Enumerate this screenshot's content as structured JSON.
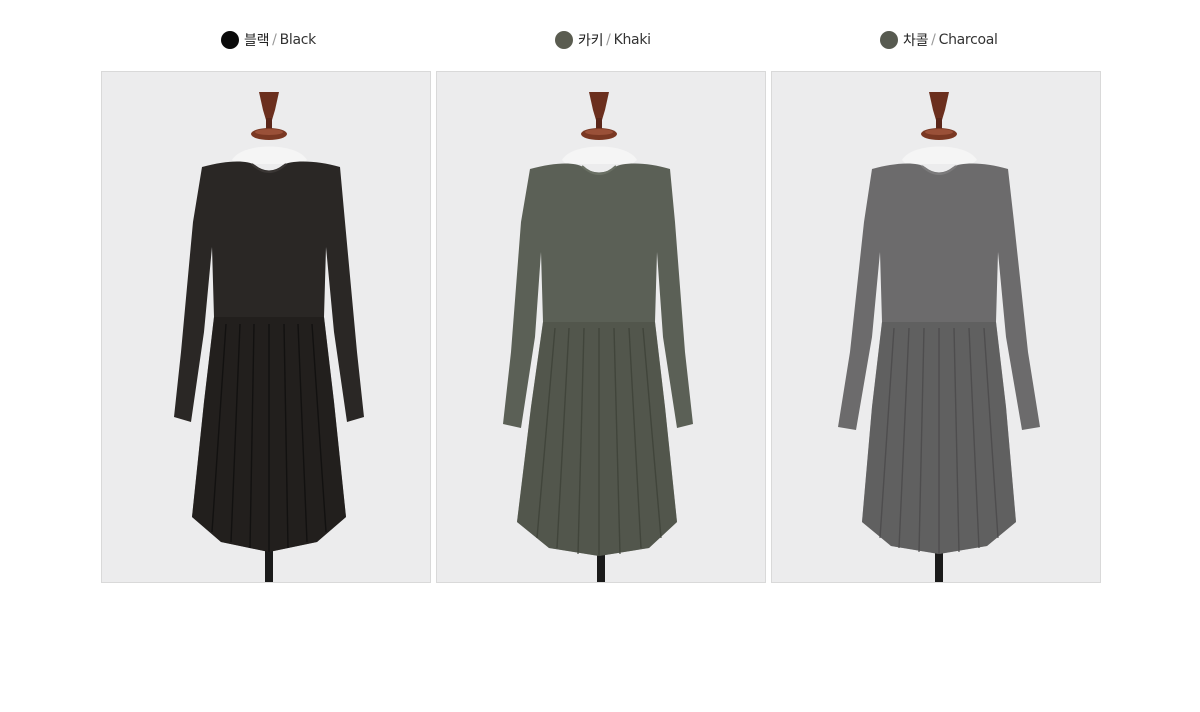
{
  "colors": [
    {
      "korean": "블랙",
      "separator": "/",
      "english": "Black",
      "swatch": "#0a0a0a",
      "dress_fill": "#2a2725",
      "dress_shadow": "#1b1918"
    },
    {
      "korean": "카키",
      "separator": "/",
      "english": "Khaki",
      "swatch": "#5a5c50",
      "dress_fill": "#5b6056",
      "dress_shadow": "#4a4e45"
    },
    {
      "korean": "차콜",
      "separator": "/",
      "english": "Charcoal",
      "swatch": "#575a50",
      "dress_fill": "#6c6b6c",
      "dress_shadow": "#585758"
    }
  ],
  "background": "#ececed",
  "stand_wood": "#6b2f1e"
}
